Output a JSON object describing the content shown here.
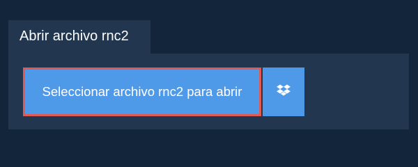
{
  "tab": {
    "title": "Abrir archivo rnc2"
  },
  "actions": {
    "open_label": "Seleccionar archivo rnc2 para abrir",
    "dropbox_icon": "dropbox-icon"
  },
  "colors": {
    "background": "#13253b",
    "panel": "#22374f",
    "button": "#4e9ae8",
    "highlight_border": "#de5b55",
    "text": "#ffffff"
  }
}
